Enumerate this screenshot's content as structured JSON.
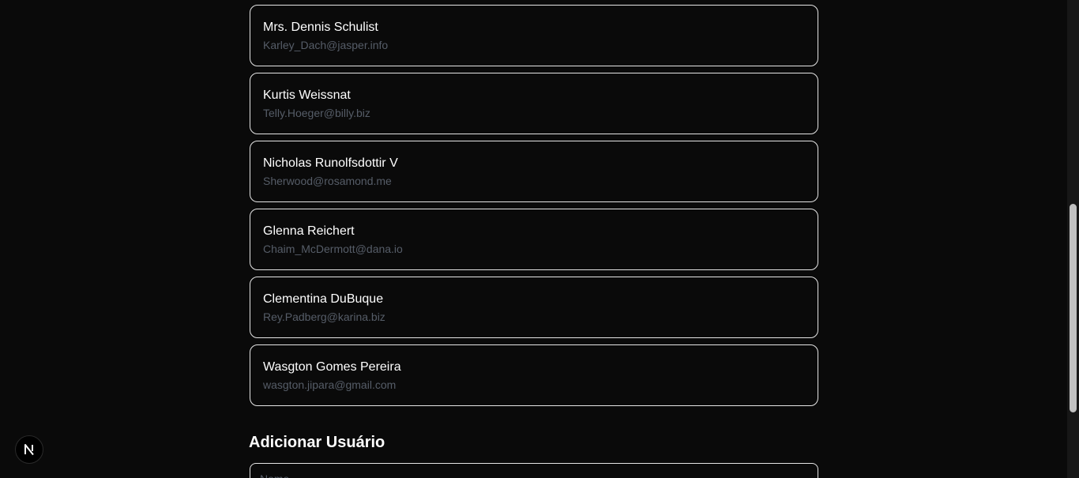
{
  "users": [
    {
      "name": "Mrs. Dennis Schulist",
      "email": "Karley_Dach@jasper.info"
    },
    {
      "name": "Kurtis Weissnat",
      "email": "Telly.Hoeger@billy.biz"
    },
    {
      "name": "Nicholas Runolfsdottir V",
      "email": "Sherwood@rosamond.me"
    },
    {
      "name": "Glenna Reichert",
      "email": "Chaim_McDermott@dana.io"
    },
    {
      "name": "Clementina DuBuque",
      "email": "Rey.Padberg@karina.biz"
    },
    {
      "name": "Wasgton Gomes Pereira",
      "email": "wasgton.jipara@gmail.com"
    }
  ],
  "add_user": {
    "title": "Adicionar Usuário",
    "name_placeholder": "Nome"
  },
  "dev_badge": {
    "icon": "nextjs-logo-icon"
  },
  "colors": {
    "background": "#0a0a0a",
    "card_border": "#e5e5e5",
    "name_text": "#ffffff",
    "email_text": "#565d68"
  }
}
